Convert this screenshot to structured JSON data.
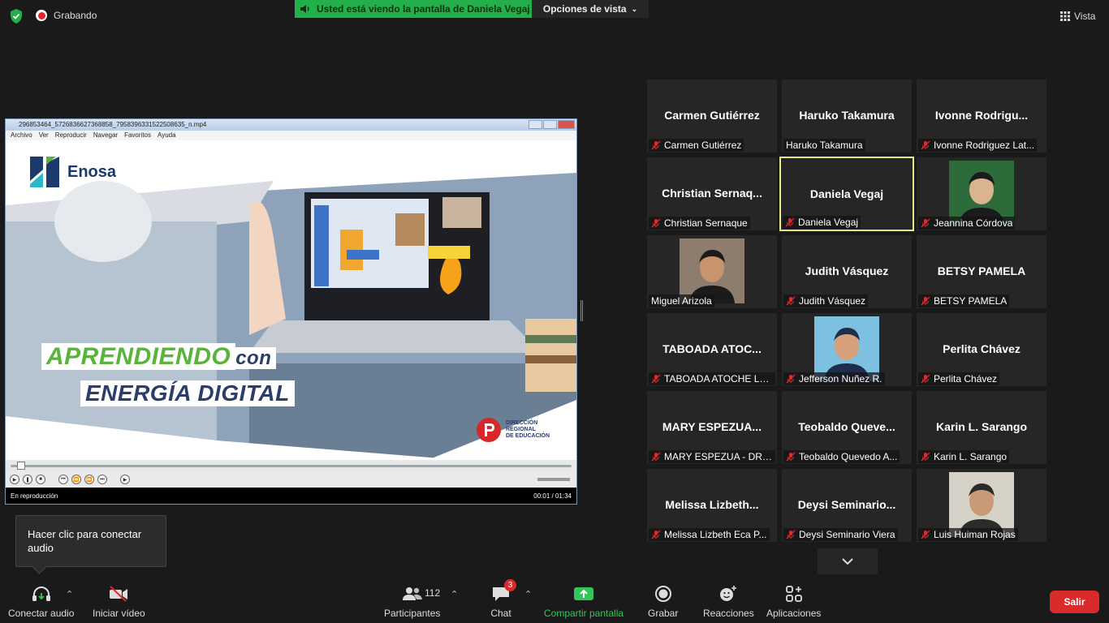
{
  "top": {
    "recording_label": "Grabando",
    "share_banner": "Usted está viendo la pantalla de Daniela Vegaj",
    "view_options": "Opciones de vista",
    "view_label": "Vista"
  },
  "player": {
    "title": "296853464_5726836627368858_7958396331522508635_n.mp4",
    "menu": [
      "Archivo",
      "Ver",
      "Reproducir",
      "Navegar",
      "Favoritos",
      "Ayuda"
    ],
    "brand": "Enosa",
    "slogan_a": "APRENDIENDO",
    "slogan_b": "con",
    "slogan_c": "ENERGÍA DIGITAL",
    "org_line1": "DIRECCIÓN",
    "org_line2": "REGIONAL",
    "org_line3": "DE EDUCACIÓN",
    "status": "En reproducción",
    "time": "00:01 / 01:34",
    "progress_fraction": 0.01
  },
  "participants": [
    {
      "big": "Carmen Gutiérrez",
      "label": "Carmen Gutiérrez",
      "muted": true,
      "photo": false
    },
    {
      "big": "Haruko Takamura",
      "label": "Haruko Takamura",
      "muted": false,
      "photo": false
    },
    {
      "big": "Ivonne  Rodrigu...",
      "label": "Ivonne Rodriguez Lat...",
      "muted": true,
      "photo": false
    },
    {
      "big": "Christian  Sernaq...",
      "label": "Christian Sernaque",
      "muted": true,
      "photo": false
    },
    {
      "big": "Daniela Vegaj",
      "label": "Daniela Vegaj",
      "muted": true,
      "photo": false,
      "active": true
    },
    {
      "big": "",
      "label": "Jeannina Córdova",
      "muted": true,
      "photo": true
    },
    {
      "big": "",
      "label": "Miguel Arizola",
      "muted": false,
      "photo": true
    },
    {
      "big": "Judith Vásquez",
      "label": "Judith Vásquez",
      "muted": true,
      "photo": false
    },
    {
      "big": "BETSY PAMELA",
      "label": "BETSY PAMELA",
      "muted": true,
      "photo": false
    },
    {
      "big": "TABOADA  ATOC...",
      "label": "TABOADA ATOCHE LU...",
      "muted": true,
      "photo": false
    },
    {
      "big": "",
      "label": "Jefferson Nuñez R.",
      "muted": true,
      "photo": true
    },
    {
      "big": "Perlita Chávez",
      "label": "Perlita Chávez",
      "muted": true,
      "photo": false
    },
    {
      "big": "MARY  ESPEZUA...",
      "label": "MARY ESPEZUA - DREP",
      "muted": true,
      "photo": false
    },
    {
      "big": "Teobaldo  Queve...",
      "label": "Teobaldo Quevedo A...",
      "muted": true,
      "photo": false
    },
    {
      "big": "Karin L. Sarango",
      "label": "Karin L. Sarango",
      "muted": true,
      "photo": false
    },
    {
      "big": "Melissa  Lizbeth...",
      "label": "Melissa Lizbeth Eca P...",
      "muted": true,
      "photo": false
    },
    {
      "big": "Deysi  Seminario...",
      "label": "Deysi Seminario Viera",
      "muted": true,
      "photo": false
    },
    {
      "big": "",
      "label": "Luis Huiman Rojas",
      "muted": true,
      "photo": true
    }
  ],
  "tooltip": "Hacer clic para conectar audio",
  "toolbar": {
    "audio": "Conectar audio",
    "video": "Iniciar vídeo",
    "participants": "Participantes",
    "participants_count": "112",
    "chat": "Chat",
    "chat_badge": "3",
    "share": "Compartir pantalla",
    "record": "Grabar",
    "reactions": "Reacciones",
    "apps": "Aplicaciones",
    "leave": "Salir"
  },
  "colors": {
    "banner_green": "#23b04a",
    "leave_red": "#d92b2b",
    "active_border": "#e8ee86",
    "share_green": "#33c45a"
  }
}
